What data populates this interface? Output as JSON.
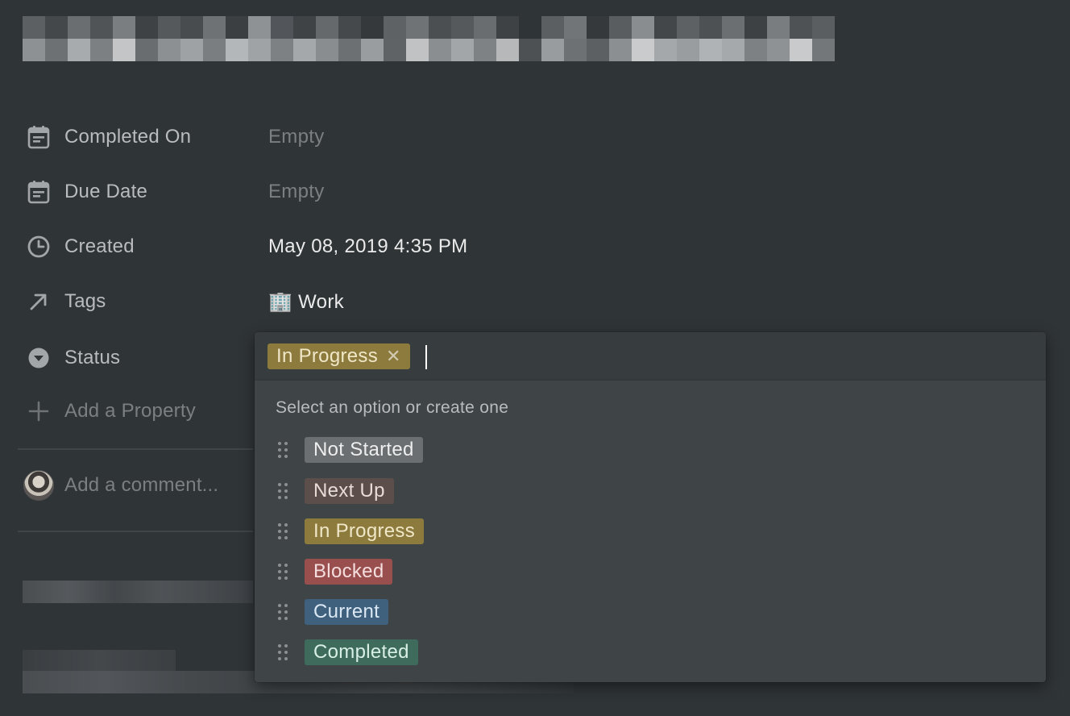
{
  "page": {
    "background": "#2f3437"
  },
  "properties": [
    {
      "key": "completed_on",
      "icon": "calendar-icon",
      "label": "Completed On",
      "value": "Empty",
      "empty": true
    },
    {
      "key": "due_date",
      "icon": "calendar-icon",
      "label": "Due Date",
      "value": "Empty",
      "empty": true
    },
    {
      "key": "created",
      "icon": "clock-icon",
      "label": "Created",
      "value": "May 08, 2019 4:35 PM",
      "empty": false
    },
    {
      "key": "tags",
      "icon": "arrow-up-right-icon",
      "label": "Tags",
      "value": "Work",
      "value_emoji": "🏢",
      "empty": false
    },
    {
      "key": "status",
      "icon": "chevron-down-circle-icon",
      "label": "Status"
    }
  ],
  "add_property": {
    "icon": "plus-icon",
    "label": "Add a Property"
  },
  "comment": {
    "placeholder": "Add a comment..."
  },
  "status_dropdown": {
    "selected": {
      "label": "In Progress",
      "color": "#8c7b3d",
      "remove_icon": "close-icon",
      "remove_glyph": "✕"
    },
    "hint": "Select an option or create one",
    "options": [
      {
        "label": "Not Started",
        "color": "#6b6f72"
      },
      {
        "label": "Next Up",
        "color": "#5c4f4b"
      },
      {
        "label": "In Progress",
        "color": "#8c7b3d"
      },
      {
        "label": "Blocked",
        "color": "#9a4f4f"
      },
      {
        "label": "Current",
        "color": "#3f617d"
      },
      {
        "label": "Completed",
        "color": "#3e6b5c"
      }
    ]
  }
}
